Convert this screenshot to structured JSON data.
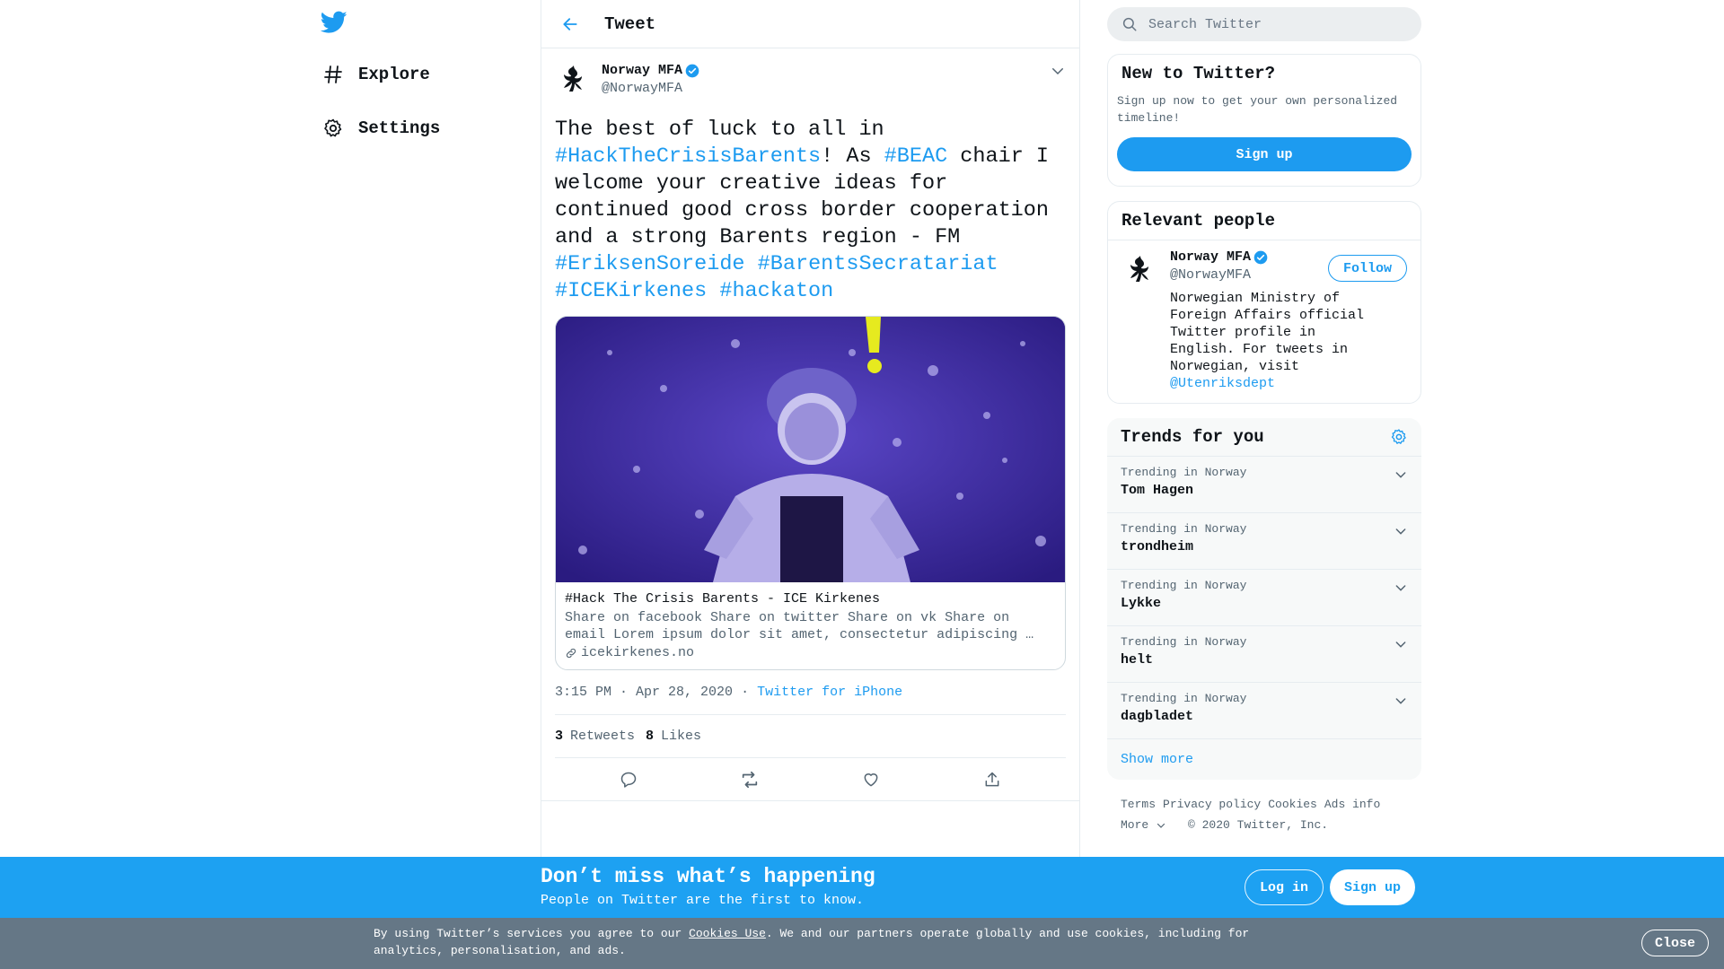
{
  "nav": {
    "items": [
      {
        "label": "Explore",
        "icon": "hashtag-icon"
      },
      {
        "label": "Settings",
        "icon": "gear-icon"
      }
    ]
  },
  "header": {
    "title": "Tweet"
  },
  "tweet": {
    "author_name": "Norway MFA",
    "author_handle": "@NorwayMFA",
    "text_parts": [
      {
        "t": "The best of luck to all in ",
        "tag": false
      },
      {
        "t": "#HackTheCrisisBarents",
        "tag": true
      },
      {
        "t": "! As ",
        "tag": false
      },
      {
        "t": "#BEAC",
        "tag": true
      },
      {
        "t": " chair I welcome your creative ideas for continued good cross border cooperation and a strong Barents region - FM ",
        "tag": false
      },
      {
        "t": "#EriksenSoreide",
        "tag": true
      },
      {
        "t": " ",
        "tag": false
      },
      {
        "t": "#BarentsSecratariat",
        "tag": true
      },
      {
        "t": " ",
        "tag": false
      },
      {
        "t": "#ICEKirkenes",
        "tag": true
      },
      {
        "t": " ",
        "tag": false
      },
      {
        "t": "#hackaton",
        "tag": true
      }
    ],
    "card": {
      "title": "#Hack The Crisis Barents - ICE Kirkenes",
      "description": "Share on facebook Share on twitter Share on vk Share on email Lorem ipsum dolor sit amet, consectetur adipiscing …",
      "domain": "icekirkenes.no"
    },
    "time": "3:15 PM · Apr 28, 2020",
    "separator": "·",
    "source": "Twitter for iPhone",
    "retweets_count": "3",
    "retweets_label": "Retweets",
    "likes_count": "8",
    "likes_label": "Likes"
  },
  "search": {
    "placeholder": "Search Twitter"
  },
  "new_panel": {
    "title": "New to Twitter?",
    "description": "Sign up now to get your own personalized timeline!",
    "button": "Sign up"
  },
  "relevant": {
    "title": "Relevant people",
    "name": "Norway MFA",
    "handle": "@NorwayMFA",
    "follow": "Follow",
    "bio": "Norwegian Ministry of Foreign Affairs official Twitter profile in English. For tweets in Norwegian, visit ",
    "bio_link": "@Utenriksdept"
  },
  "trends": {
    "title": "Trends for you",
    "items": [
      {
        "context": "Trending in Norway",
        "name": "Tom Hagen"
      },
      {
        "context": "Trending in Norway",
        "name": "trondheim"
      },
      {
        "context": "Trending in Norway",
        "name": "Lykke"
      },
      {
        "context": "Trending in Norway",
        "name": "helt"
      },
      {
        "context": "Trending in Norway",
        "name": "dagbladet"
      }
    ],
    "show_more": "Show more"
  },
  "footer": {
    "links": [
      "Terms",
      "Privacy policy",
      "Cookies",
      "Ads info"
    ],
    "more": "More",
    "copyright": "© 2020 Twitter, Inc."
  },
  "bottom_bar": {
    "title": "Don’t miss what’s happening",
    "subtitle": "People on Twitter are the first to know.",
    "login": "Log in",
    "signup": "Sign up"
  },
  "cookie": {
    "text_before": "By using Twitter’s services you agree to our ",
    "link": "Cookies Use",
    "text_after": ". We and our partners operate globally and use cookies, including for analytics, personalisation, and ads.",
    "close": "Close"
  },
  "colors": {
    "accent": "#1d9bf0",
    "bottom_bar": "#1da1f2",
    "cookie_bar": "#657786"
  }
}
